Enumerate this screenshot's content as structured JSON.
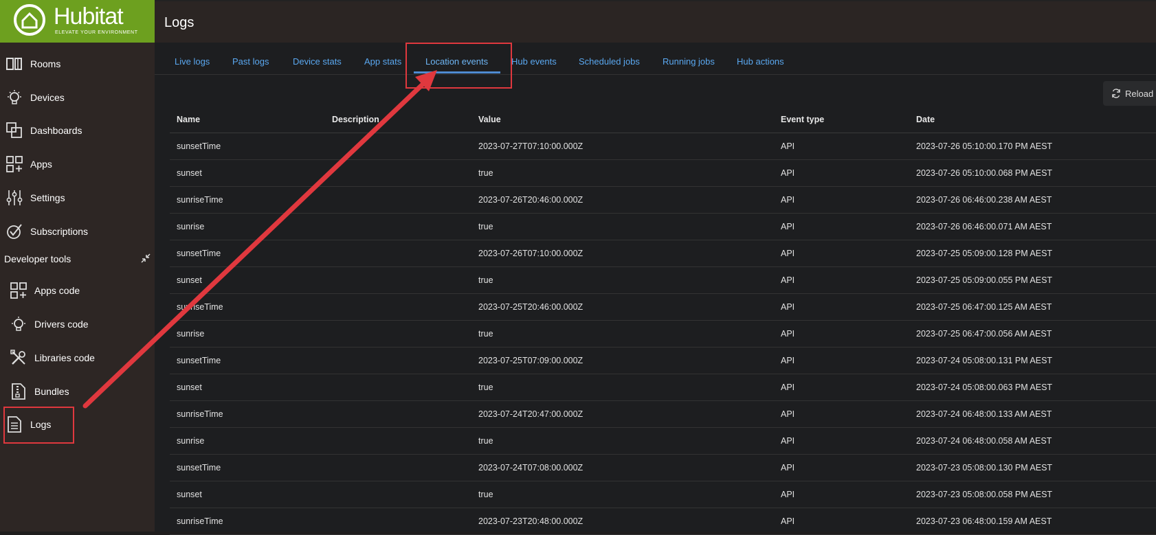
{
  "brand": {
    "name": "Hubitat",
    "tagline": "ELEVATE YOUR ENVIRONMENT"
  },
  "header": {
    "title": "Logs"
  },
  "sidebar": {
    "items": [
      {
        "label": "Rooms",
        "icon": "rooms-icon"
      },
      {
        "label": "Devices",
        "icon": "bulb-icon"
      },
      {
        "label": "Dashboards",
        "icon": "dashboards-icon"
      },
      {
        "label": "Apps",
        "icon": "apps-icon"
      },
      {
        "label": "Settings",
        "icon": "sliders-icon"
      },
      {
        "label": "Subscriptions",
        "icon": "check-circle-icon"
      }
    ],
    "developer_tools_label": "Developer tools",
    "dev_items": [
      {
        "label": "Apps code",
        "icon": "apps-icon"
      },
      {
        "label": "Drivers code",
        "icon": "bulb-icon"
      },
      {
        "label": "Libraries code",
        "icon": "tools-icon"
      },
      {
        "label": "Bundles",
        "icon": "zip-file-icon"
      },
      {
        "label": "Logs",
        "icon": "document-icon"
      }
    ]
  },
  "tabs": [
    "Live logs",
    "Past logs",
    "Device stats",
    "App stats",
    "Location events",
    "Hub events",
    "Scheduled jobs",
    "Running jobs",
    "Hub actions"
  ],
  "active_tab": "Location events",
  "reload_label": "Reload",
  "table": {
    "headers": [
      "Name",
      "Description",
      "Value",
      "Event type",
      "Date"
    ],
    "rows": [
      [
        "sunsetTime",
        "",
        "2023-07-27T07:10:00.000Z",
        "API",
        "2023-07-26 05:10:00.170 PM AEST"
      ],
      [
        "sunset",
        "",
        "true",
        "API",
        "2023-07-26 05:10:00.068 PM AEST"
      ],
      [
        "sunriseTime",
        "",
        "2023-07-26T20:46:00.000Z",
        "API",
        "2023-07-26 06:46:00.238 AM AEST"
      ],
      [
        "sunrise",
        "",
        "true",
        "API",
        "2023-07-26 06:46:00.071 AM AEST"
      ],
      [
        "sunsetTime",
        "",
        "2023-07-26T07:10:00.000Z",
        "API",
        "2023-07-25 05:09:00.128 PM AEST"
      ],
      [
        "sunset",
        "",
        "true",
        "API",
        "2023-07-25 05:09:00.055 PM AEST"
      ],
      [
        "sunriseTime",
        "",
        "2023-07-25T20:46:00.000Z",
        "API",
        "2023-07-25 06:47:00.125 AM AEST"
      ],
      [
        "sunrise",
        "",
        "true",
        "API",
        "2023-07-25 06:47:00.056 AM AEST"
      ],
      [
        "sunsetTime",
        "",
        "2023-07-25T07:09:00.000Z",
        "API",
        "2023-07-24 05:08:00.131 PM AEST"
      ],
      [
        "sunset",
        "",
        "true",
        "API",
        "2023-07-24 05:08:00.063 PM AEST"
      ],
      [
        "sunriseTime",
        "",
        "2023-07-24T20:47:00.000Z",
        "API",
        "2023-07-24 06:48:00.133 AM AEST"
      ],
      [
        "sunrise",
        "",
        "true",
        "API",
        "2023-07-24 06:48:00.058 AM AEST"
      ],
      [
        "sunsetTime",
        "",
        "2023-07-24T07:08:00.000Z",
        "API",
        "2023-07-23 05:08:00.130 PM AEST"
      ],
      [
        "sunset",
        "",
        "true",
        "API",
        "2023-07-23 05:08:00.058 PM AEST"
      ],
      [
        "sunriseTime",
        "",
        "2023-07-23T20:48:00.000Z",
        "API",
        "2023-07-23 06:48:00.159 AM AEST"
      ]
    ]
  },
  "colors": {
    "brand": "#6da01f",
    "link": "#5aa8f0",
    "annotation": "#e0383e"
  }
}
